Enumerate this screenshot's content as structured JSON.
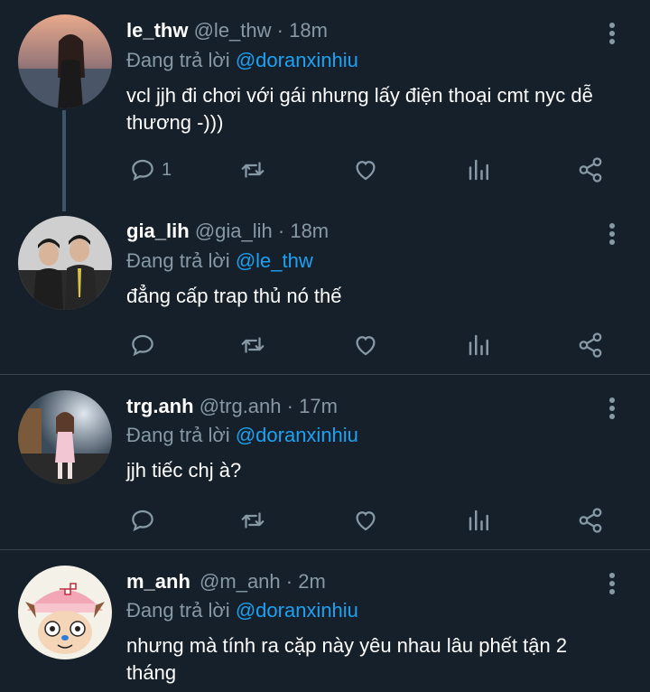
{
  "reply_prefix": "Đang trả lời",
  "tweets": [
    {
      "name": "le_thw",
      "handle": "@le_thw",
      "sep": "·",
      "time": "18m",
      "reply_to": "@doranxinhiu",
      "text": "vcl jjh đi chơi với gái nhưng lấy điện thoại cmt nyc dễ thương -)))",
      "reply_count": "1"
    },
    {
      "name": "gia_lih",
      "handle": "@gia_lih",
      "sep": "·",
      "time": "18m",
      "reply_to": "@le_thw",
      "text": "đẳng cấp trap thủ nó thế",
      "reply_count": ""
    },
    {
      "name": "trg.anh",
      "handle": "@trg.anh",
      "sep": "·",
      "time": "17m",
      "reply_to": "@doranxinhiu",
      "text": "jjh tiếc chj à?",
      "reply_count": ""
    },
    {
      "name": "m_anh",
      "handle": "@m_anh",
      "sep": "·",
      "time": "2m",
      "reply_to": "@doranxinhiu",
      "text": "nhưng mà tính ra cặp này yêu nhau lâu phết tận 2 tháng",
      "reply_count": ""
    }
  ],
  "icons": [
    "reply-icon",
    "retweet-icon",
    "like-icon",
    "analytics-icon",
    "share-icon",
    "more-icon"
  ],
  "colors": {
    "background": "#15202b",
    "muted": "#8899a6",
    "link": "#1da1f2",
    "divider": "#38444d"
  }
}
